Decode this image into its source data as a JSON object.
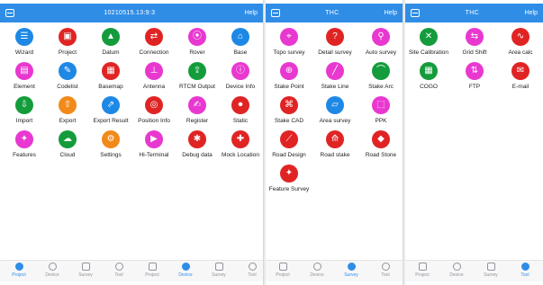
{
  "colors": {
    "header": "#2f8de6",
    "blue": "#1e88e5",
    "red": "#e02424",
    "green": "#149c3c",
    "pink": "#e838d0",
    "orange": "#f28a1a",
    "active_tab": "#2f8de6"
  },
  "panel_project": {
    "header": {
      "title": "10210515.13:9:3",
      "right": "Help"
    },
    "items": [
      {
        "label": "Wizard",
        "icon": "wizard-icon",
        "color": "blue",
        "glyph": "☰"
      },
      {
        "label": "Project",
        "icon": "project-icon",
        "color": "red",
        "glyph": "▣"
      },
      {
        "label": "Datum",
        "icon": "datum-icon",
        "color": "green",
        "glyph": "▲"
      },
      {
        "label": "Connection",
        "icon": "connection-icon",
        "color": "red",
        "glyph": "⇄"
      },
      {
        "label": "Rover",
        "icon": "rover-icon",
        "color": "pink",
        "glyph": "⦿"
      },
      {
        "label": "Base",
        "icon": "base-icon",
        "color": "blue",
        "glyph": "⌂"
      },
      {
        "label": "Element",
        "icon": "element-icon",
        "color": "pink",
        "glyph": "▤"
      },
      {
        "label": "Codelist",
        "icon": "codelist-icon",
        "color": "blue",
        "glyph": "✎"
      },
      {
        "label": "Basemap",
        "icon": "basemap-icon",
        "color": "red",
        "glyph": "▦"
      },
      {
        "label": "Antenna",
        "icon": "antenna-icon",
        "color": "pink",
        "glyph": "⊥"
      },
      {
        "label": "RTCM Output",
        "icon": "output-icon",
        "color": "green",
        "glyph": "⇪"
      },
      {
        "label": "Device Info",
        "icon": "device-info-icon",
        "color": "pink",
        "glyph": "ⓘ"
      },
      {
        "label": "Import",
        "icon": "import-icon",
        "color": "green",
        "glyph": "⇩"
      },
      {
        "label": "Export",
        "icon": "export-icon",
        "color": "orange",
        "glyph": "⇧"
      },
      {
        "label": "Export Result",
        "icon": "export-result-icon",
        "color": "blue",
        "glyph": "⇗"
      },
      {
        "label": "Position Info",
        "icon": "position-info-icon",
        "color": "red",
        "glyph": "◎"
      },
      {
        "label": "Register",
        "icon": "register-icon",
        "color": "pink",
        "glyph": "✍"
      },
      {
        "label": "Static",
        "icon": "static-icon",
        "color": "red",
        "glyph": "⏺"
      },
      {
        "label": "Features",
        "icon": "features-icon",
        "color": "pink",
        "glyph": "✦"
      },
      {
        "label": "Cloud",
        "icon": "cloud-icon",
        "color": "green",
        "glyph": "☁"
      },
      {
        "label": "Settings",
        "icon": "settings-icon",
        "color": "orange",
        "glyph": "⚙"
      },
      {
        "label": "Hi-Terminal",
        "icon": "terminal-icon",
        "color": "pink",
        "glyph": "▶"
      },
      {
        "label": "Debug data",
        "icon": "debug-icon",
        "color": "red",
        "glyph": "✱"
      },
      {
        "label": "Mock Location",
        "icon": "mock-location-icon",
        "color": "red",
        "glyph": "✚"
      }
    ],
    "tabs": [
      {
        "label": "Project",
        "active": true
      },
      {
        "label": "Device",
        "active": false
      },
      {
        "label": "Survey",
        "active": false
      },
      {
        "label": "Tool",
        "active": false
      },
      {
        "label": "Project",
        "active": false
      },
      {
        "label": "Device",
        "active": true
      },
      {
        "label": "Survey",
        "active": false
      },
      {
        "label": "Tool",
        "active": false
      }
    ]
  },
  "panel_survey": {
    "header": {
      "title": "THC",
      "right": "Help"
    },
    "items": [
      {
        "label": "Topo survey",
        "icon": "topo-survey-icon",
        "color": "pink",
        "glyph": "⌖"
      },
      {
        "label": "Detail survey",
        "icon": "detail-survey-icon",
        "color": "red",
        "glyph": "?"
      },
      {
        "label": "Auto survey",
        "icon": "auto-survey-icon",
        "color": "pink",
        "glyph": "⚲"
      },
      {
        "label": "Stake Point",
        "icon": "stake-point-icon",
        "color": "pink",
        "glyph": "⊕"
      },
      {
        "label": "Stake Line",
        "icon": "stake-line-icon",
        "color": "pink",
        "glyph": "╱"
      },
      {
        "label": "Stake Arc",
        "icon": "stake-arc-icon",
        "color": "green",
        "glyph": "⌒"
      },
      {
        "label": "Stake CAD",
        "icon": "stake-cad-icon",
        "color": "red",
        "glyph": "⌘"
      },
      {
        "label": "Area survey",
        "icon": "area-survey-icon",
        "color": "blue",
        "glyph": "▱"
      },
      {
        "label": "PPK",
        "icon": "ppk-icon",
        "color": "pink",
        "glyph": "⬚"
      },
      {
        "label": "Road Design",
        "icon": "road-design-icon",
        "color": "red",
        "glyph": "⟋"
      },
      {
        "label": "Road stake",
        "icon": "road-stake-icon",
        "color": "red",
        "glyph": "⟰"
      },
      {
        "label": "Road Stone",
        "icon": "road-stone-icon",
        "color": "red",
        "glyph": "◆"
      },
      {
        "label": "Feature Survey",
        "icon": "feature-survey-icon",
        "color": "red",
        "glyph": "✦"
      }
    ],
    "tabs": [
      {
        "label": "Project",
        "active": false
      },
      {
        "label": "Device",
        "active": false
      },
      {
        "label": "Survey",
        "active": true
      },
      {
        "label": "Tool",
        "active": false
      }
    ]
  },
  "panel_tool": {
    "header": {
      "title": "THC",
      "right": "Help"
    },
    "items": [
      {
        "label": "Site Calibration",
        "icon": "site-calibration-icon",
        "color": "green",
        "glyph": "✕"
      },
      {
        "label": "Grid Shift",
        "icon": "grid-shift-icon",
        "color": "pink",
        "glyph": "⇆"
      },
      {
        "label": "Area calc",
        "icon": "area-calc-icon",
        "color": "red",
        "glyph": "∿"
      },
      {
        "label": "COGO",
        "icon": "cogo-icon",
        "color": "green",
        "glyph": "▦"
      },
      {
        "label": "FTP",
        "icon": "ftp-icon",
        "color": "pink",
        "glyph": "⇅"
      },
      {
        "label": "E-mail",
        "icon": "email-icon",
        "color": "red",
        "glyph": "✉"
      }
    ],
    "tabs": [
      {
        "label": "Project",
        "active": false
      },
      {
        "label": "Device",
        "active": false
      },
      {
        "label": "Survey",
        "active": false
      },
      {
        "label": "Tool",
        "active": true
      }
    ]
  }
}
